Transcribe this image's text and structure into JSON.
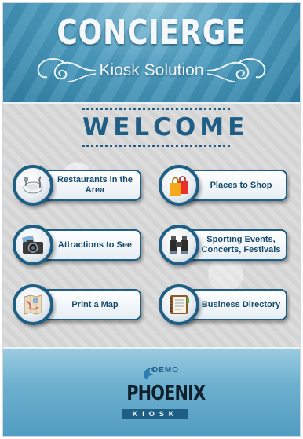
{
  "header": {
    "title": "CONCIERGE",
    "subtitle": "Kiosk Solution"
  },
  "main": {
    "welcome": "WELCOME",
    "menu": [
      {
        "label": "Restaurants in the Area",
        "icon": "plate-fork-knife-icon"
      },
      {
        "label": "Places to Shop",
        "icon": "shopping-bag-icon"
      },
      {
        "label": "Attractions to See",
        "icon": "camera-icon"
      },
      {
        "label": "Sporting Events, Concerts, Festivals",
        "icon": "binoculars-icon"
      },
      {
        "label": "Print a Map",
        "icon": "map-icon"
      },
      {
        "label": "Business Directory",
        "icon": "address-book-icon"
      }
    ]
  },
  "footer": {
    "logo_demo": "DEMO",
    "logo_main": "PHOENIX",
    "logo_sub": "KIOSK"
  },
  "colors": {
    "brand_blue": "#1f5f86",
    "header_blue": "#4d9cbf",
    "footer_blue": "#6db0cf"
  }
}
